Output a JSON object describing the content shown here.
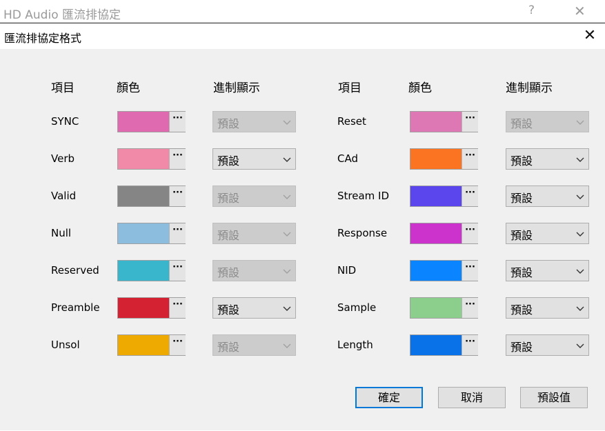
{
  "parent_window": {
    "title": "HD Audio 匯流排協定",
    "help": "?",
    "close": "✕"
  },
  "dialog": {
    "title": "匯流排協定格式",
    "close": "✕"
  },
  "headers": {
    "item": "項目",
    "color": "顏色",
    "display": "進制顯示"
  },
  "colors_swatch_dots": "···",
  "left_rows": [
    {
      "label": "SYNC",
      "color": "#e06ab0",
      "display": "預設",
      "enabled": false
    },
    {
      "label": "Verb",
      "color": "#f08aa8",
      "display": "預設",
      "enabled": true
    },
    {
      "label": "Valid",
      "color": "#858585",
      "display": "預設",
      "enabled": false
    },
    {
      "label": "Null",
      "color": "#8cbcde",
      "display": "預設",
      "enabled": false
    },
    {
      "label": "Reserved",
      "color": "#39b6cc",
      "display": "預設",
      "enabled": false
    },
    {
      "label": "Preamble",
      "color": "#d52232",
      "display": "預設",
      "enabled": true
    },
    {
      "label": "Unsol",
      "color": "#eeaa00",
      "display": "預設",
      "enabled": false
    }
  ],
  "right_rows": [
    {
      "label": "Reset",
      "color": "#dd78b4",
      "display": "預設",
      "enabled": false
    },
    {
      "label": "CAd",
      "color": "#fb7422",
      "display": "預設",
      "enabled": true
    },
    {
      "label": "Stream ID",
      "color": "#5b45ec",
      "display": "預設",
      "enabled": true
    },
    {
      "label": "Response",
      "color": "#cc33cc",
      "display": "預設",
      "enabled": true
    },
    {
      "label": "NID",
      "color": "#0a84ff",
      "display": "預設",
      "enabled": true
    },
    {
      "label": "Sample",
      "color": "#8ccf8c",
      "display": "預設",
      "enabled": true
    },
    {
      "label": "Length",
      "color": "#0a72e8",
      "display": "預設",
      "enabled": true
    }
  ],
  "buttons": {
    "ok": "確定",
    "cancel": "取消",
    "default": "預設值"
  }
}
